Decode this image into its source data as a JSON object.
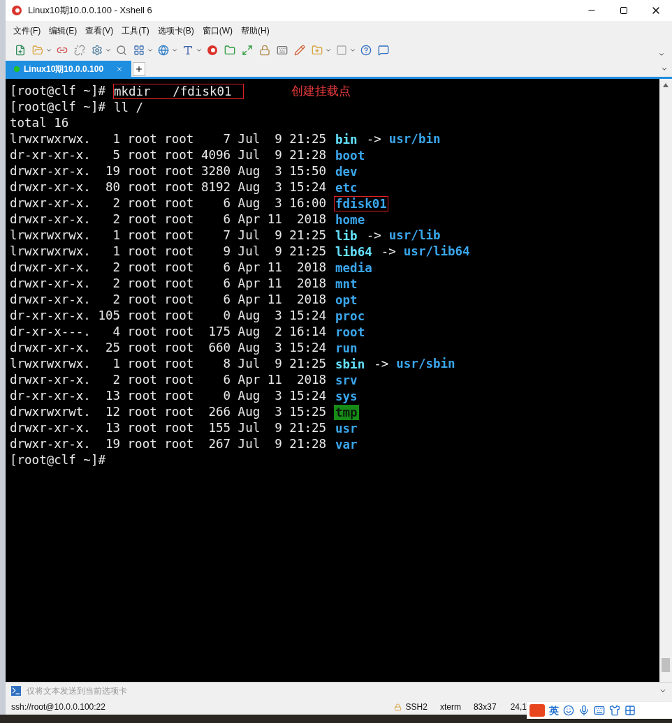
{
  "window": {
    "title": "Linux10期10.0.0.100 - Xshell 6"
  },
  "menu": [
    "文件(F)",
    "编辑(E)",
    "查看(V)",
    "工具(T)",
    "选项卡(B)",
    "窗口(W)",
    "帮助(H)"
  ],
  "tabs": [
    {
      "label": "Linux10期10.0.0.100",
      "selected": true,
      "connected": true
    }
  ],
  "terminal": {
    "lines": [
      {
        "kind": "command",
        "prompt": "[root@clf ~]#",
        "command": "mkdir   /fdisk01",
        "highlighted": true
      },
      {
        "kind": "command",
        "prompt": "[root@clf ~]#",
        "command": "ll /",
        "highlighted": false
      },
      {
        "kind": "text",
        "text": "total 16"
      },
      {
        "kind": "entry",
        "info": "lrwxrwxrwx.   1 root root    7 Jul  9 21:25",
        "file": {
          "kind": "link",
          "name": "bin",
          "arrow": "->",
          "target": "usr/bin"
        },
        "highlighted": false
      },
      {
        "kind": "entry",
        "info": "dr-xr-xr-x.   5 root root 4096 Jul  9 21:28",
        "file": {
          "kind": "dir",
          "name": "boot"
        },
        "highlighted": false
      },
      {
        "kind": "entry",
        "info": "drwxr-xr-x.  19 root root 3280 Aug  3 15:50",
        "file": {
          "kind": "dir",
          "name": "dev"
        },
        "highlighted": false
      },
      {
        "kind": "entry",
        "info": "drwxr-xr-x.  80 root root 8192 Aug  3 15:24",
        "file": {
          "kind": "dir",
          "name": "etc"
        },
        "highlighted": false
      },
      {
        "kind": "entry",
        "info": "drwxr-xr-x.   2 root root    6 Aug  3 16:00",
        "file": {
          "kind": "dir",
          "name": "fdisk01"
        },
        "highlighted": true
      },
      {
        "kind": "entry",
        "info": "drwxr-xr-x.   2 root root    6 Apr 11  2018",
        "file": {
          "kind": "dir",
          "name": "home"
        },
        "highlighted": false
      },
      {
        "kind": "entry",
        "info": "lrwxrwxrwx.   1 root root    7 Jul  9 21:25",
        "file": {
          "kind": "link",
          "name": "lib",
          "arrow": "->",
          "target": "usr/lib"
        },
        "highlighted": false
      },
      {
        "kind": "entry",
        "info": "lrwxrwxrwx.   1 root root    9 Jul  9 21:25",
        "file": {
          "kind": "link",
          "name": "lib64",
          "arrow": "->",
          "target": "usr/lib64"
        },
        "highlighted": false
      },
      {
        "kind": "entry",
        "info": "drwxr-xr-x.   2 root root    6 Apr 11  2018",
        "file": {
          "kind": "dir",
          "name": "media"
        },
        "highlighted": false
      },
      {
        "kind": "entry",
        "info": "drwxr-xr-x.   2 root root    6 Apr 11  2018",
        "file": {
          "kind": "dir",
          "name": "mnt"
        },
        "highlighted": false
      },
      {
        "kind": "entry",
        "info": "drwxr-xr-x.   2 root root    6 Apr 11  2018",
        "file": {
          "kind": "dir",
          "name": "opt"
        },
        "highlighted": false
      },
      {
        "kind": "entry",
        "info": "dr-xr-xr-x. 105 root root    0 Aug  3 15:24",
        "file": {
          "kind": "dir",
          "name": "proc"
        },
        "highlighted": false
      },
      {
        "kind": "entry",
        "info": "dr-xr-x---.   4 root root  175 Aug  2 16:14",
        "file": {
          "kind": "dir",
          "name": "root"
        },
        "highlighted": false
      },
      {
        "kind": "entry",
        "info": "drwxr-xr-x.  25 root root  660 Aug  3 15:24",
        "file": {
          "kind": "dir",
          "name": "run"
        },
        "highlighted": false
      },
      {
        "kind": "entry",
        "info": "lrwxrwxrwx.   1 root root    8 Jul  9 21:25",
        "file": {
          "kind": "link",
          "name": "sbin",
          "arrow": "->",
          "target": "usr/sbin"
        },
        "highlighted": false
      },
      {
        "kind": "entry",
        "info": "drwxr-xr-x.   2 root root    6 Apr 11  2018",
        "file": {
          "kind": "dir",
          "name": "srv"
        },
        "highlighted": false
      },
      {
        "kind": "entry",
        "info": "dr-xr-xr-x.  13 root root    0 Aug  3 15:24",
        "file": {
          "kind": "dir",
          "name": "sys"
        },
        "highlighted": false
      },
      {
        "kind": "entry",
        "info": "drwxrwxrwt.  12 root root  266 Aug  3 15:25",
        "file": {
          "kind": "sticky",
          "name": "tmp"
        },
        "highlighted": false
      },
      {
        "kind": "entry",
        "info": "drwxr-xr-x.  13 root root  155 Jul  9 21:25",
        "file": {
          "kind": "dir",
          "name": "usr"
        },
        "highlighted": false
      },
      {
        "kind": "entry",
        "info": "drwxr-xr-x.  19 root root  267 Jul  9 21:28",
        "file": {
          "kind": "dir",
          "name": "var"
        },
        "highlighted": false
      },
      {
        "kind": "command",
        "prompt": "[root@clf ~]#"
      }
    ],
    "annotation": "创建挂载点"
  },
  "compose_bar": {
    "placeholder": "仅将文本发送到当前选项卡"
  },
  "status_bar": {
    "address": "ssh://root@10.0.0.100:22",
    "protocol": "SSH2",
    "terminal_type": "xterm",
    "size": "83x37",
    "cursor": "24,1"
  },
  "ime_toolbar": {
    "language": "英"
  }
}
